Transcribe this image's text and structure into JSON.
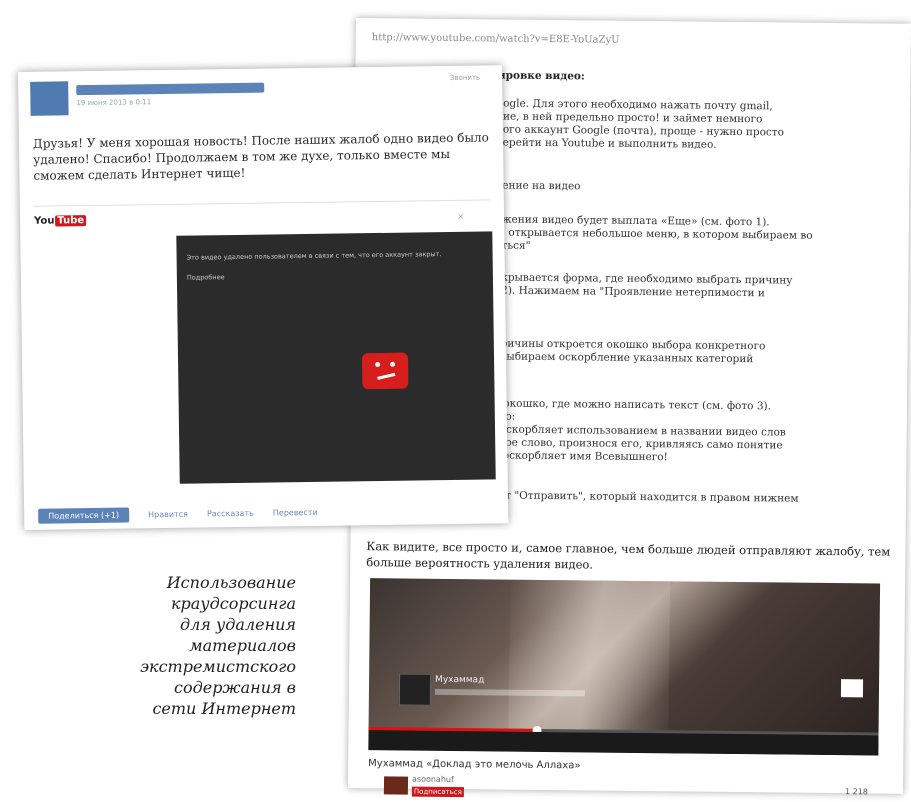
{
  "caption": {
    "lines": [
      "Использование",
      "краудсорсинга",
      "для удаления",
      "материалов",
      "экстремистского",
      "содержания в",
      "сети Интернет"
    ]
  },
  "post": {
    "text": "Друзья! У меня хорошая новость! После наших жалоб одно видео было удалено! Спасибо! Продолжаем в том же духе, только вместе мы сможем сделать Интернет чище!",
    "date": "19 июня 2013 в 0:11",
    "more_label": "Звонить",
    "youtube_logo_left": "You",
    "youtube_logo_right": "Tube",
    "close_symbol": "×",
    "player": {
      "error_line1": "Это видео удалено пользователем в связи с тем, что его аккаунт закрыт.",
      "error_line2": "Подробнее"
    },
    "footer": {
      "share_button": "Поделиться (+1)",
      "link_1": "Нравится",
      "link_2": "Рассказать",
      "link_3": "Перевести"
    }
  },
  "instructions": {
    "url": "http://www.youtube.com/watch?v=E8E-YoUaZyU",
    "heading": "Инструкция по блокировке видео:",
    "lines": [
      "...ogle. Для этого необходимо нажать почту gmail,",
      "...ие, в ней предельно просто! и займет немного",
      "...ого аккаунт Google (почта), проще - нужно просто",
      "...ерейти на Youtube и выполнить видео.",
      "...ение на видео",
      "...жения видео будет выплата «Еще» (см. фото 1).",
      "..., открывается небольшое меню, в котором выбираем во",
      "...ться\"",
      "...крывается форма, где необходимо выбрать причину",
      "...2). Нажимаем на \"Проявление нетерпимости и",
      "...ричины откроется окошко выбора конкретного",
      "...выбираем оскорбление указанных категорий",
      "... окошко, где можно написать текст (см. фото 3).",
      "...го:",
      "...оскорбляет использованием в названии видео слов",
      "...тое слово, произнося его, кривляясь само понятие",
      "... оскорбляет имя Всевышнего!",
      "...ет \"Отправить\", который находится в правом нижнем"
    ],
    "conclusion": "Как видите, все просто и, самое главное, чем больше людей отправляют жалобу, тем больше вероятность удаления видео.",
    "video": {
      "title": "Мухаммад",
      "progress": 0.33
    },
    "video_info": {
      "title": "Мухаммад «Доклад это мелочь Аллаха»",
      "channel": "asoonahuf",
      "subscribe": "Подписаться",
      "views": "1 218"
    }
  }
}
